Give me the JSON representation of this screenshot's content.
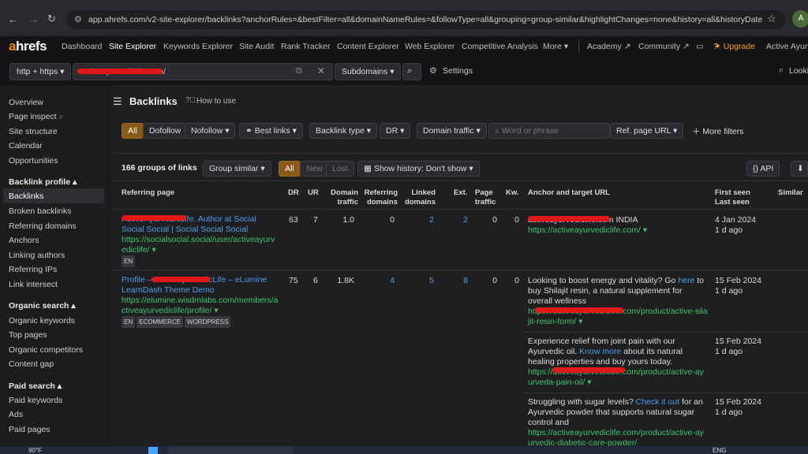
{
  "browser": {
    "url": "app.ahrefs.com/v2-site-explorer/backlinks?anchorRules=&bestFilter=all&domainNameRules=&followType=all&grouping=group-similar&highlightChanges=none&history=all&historyDateRan..."
  },
  "nav": {
    "logo_a": "a",
    "logo_rest": "hrefs",
    "items": [
      "Dashboard",
      "Site Explorer",
      "Keywords Explorer",
      "Site Audit",
      "Rank Tracker",
      "Content Explorer",
      "Web Explorer",
      "Competitive Analysis",
      "More"
    ],
    "academy": "Academy",
    "community": "Community",
    "upgrade": "Upgrade",
    "account": "Active Ayurv"
  },
  "search": {
    "protocol": "http + https",
    "target": "activeayurvedicife.com/",
    "mode": "Subdomains",
    "settings": "Settings",
    "right": "Looki"
  },
  "sidebar": {
    "items_top": [
      "Overview",
      "Page inspect",
      "Site structure",
      "Calendar",
      "Opportunities"
    ],
    "backlink_profile": "Backlink profile",
    "backlink_items": [
      "Backlinks",
      "Broken backlinks",
      "Referring domains",
      "Anchors",
      "Linking authors",
      "Referring IPs",
      "Link intersect"
    ],
    "organic_search": "Organic search",
    "organic_items": [
      "Organic keywords",
      "Top pages",
      "Organic competitors",
      "Content gap"
    ],
    "paid_search": "Paid search",
    "paid_items": [
      "Paid keywords",
      "Ads",
      "Paid pages"
    ]
  },
  "main": {
    "title": "Backlinks",
    "how_to": "How to use",
    "filters": [
      "All",
      "Dofollow",
      "Nofollow",
      "Best links",
      "Backlink type",
      "DR",
      "Domain traffic"
    ],
    "search_placeholder": "Word or phrase",
    "ref_page_url": "Ref. page URL",
    "more_filters": "More filters",
    "groups_count": "166 groups of links",
    "group_similar": "Group similar",
    "seg": [
      "All",
      "New",
      "Lost"
    ],
    "show_history": "Show history: Don't show",
    "api": "API",
    "columns": {
      "referring_page": "Referring page",
      "dr": "DR",
      "ur": "UR",
      "domain_traffic": "Domain traffic",
      "referring_domains": "Referring domains",
      "linked_domains": "Linked domains",
      "ext": "Ext.",
      "page_traffic": "Page traffic",
      "kw": "Kw.",
      "anchor": "Anchor and target URL",
      "first_last": "First seen Last seen",
      "similar": "Similar"
    },
    "rows": [
      {
        "title": "ActiveAyurvedicLife, Author at Social Social Social | Social Social Social",
        "url": "https://socialsocial.social/user/activeayurvediclife/",
        "tags": [
          "EN"
        ],
        "dr": "63",
        "ur": "7",
        "traffic": "1.0",
        "ref_domains": "0",
        "linked": "2",
        "ext": "2",
        "page_traffic": "0",
        "kw": "0",
        "anchors": [
          {
            "text": "activeayurvediclife.com INDIA",
            "link": "",
            "after": "",
            "url": "https://activeayurvediclife.com/",
            "first": "4 Jan 2024",
            "last": "1 d ago"
          }
        ]
      },
      {
        "title": "Profile – ActiveAyurvedicLife – eLumine LearnDash Theme Demo",
        "url": "https://elumine.wisdmlabs.com/members/activeayurvediclife/profile/",
        "tags": [
          "EN",
          "ECOMMERCE",
          "WORDPRESS"
        ],
        "dr": "75",
        "ur": "6",
        "traffic": "1.8K",
        "ref_domains": "4",
        "linked": "5",
        "ext": "8",
        "page_traffic": "0",
        "kw": "0",
        "anchors": [
          {
            "text": "Looking to boost energy and vitality? Go ",
            "link": "here",
            "after": " to buy Shilajit resin, a natural supplement for overall wellness",
            "url": "https://activeayurvediclife.com/product/active-silajit-resin-form/",
            "first": "15 Feb 2024",
            "last": "1 d ago"
          },
          {
            "text": "Experience relief from joint pain with our Ayurvedic oil. ",
            "link": "Know more",
            "after": " about its natural healing properties and buy yours today.",
            "url": "https://activeayurvediclife.com/product/active-ayurveda-pain-oil/",
            "first": "15 Feb 2024",
            "last": "1 d ago"
          },
          {
            "text": "Struggling with sugar levels? ",
            "link": "Check it out",
            "after": " for an Ayurvedic powder that supports natural sugar control and",
            "url": "https://activeayurvediclife.com/product/active-ayurvedic-diabetic-care-powder/",
            "first": "15 Feb 2024",
            "last": "1 d ago"
          }
        ]
      }
    ]
  },
  "taskbar": {
    "weather": "90°F",
    "lang": "ENG"
  }
}
